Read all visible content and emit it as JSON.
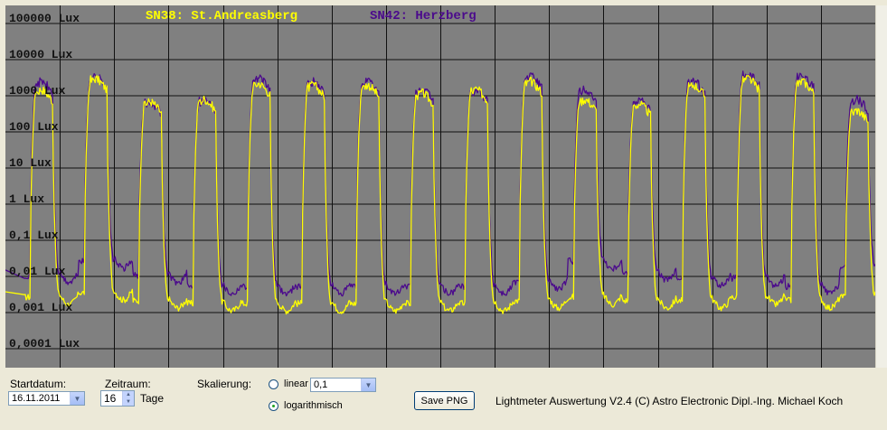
{
  "chart_data": {
    "type": "line",
    "yscale": "log",
    "ylim": [
      0.0001,
      100000
    ],
    "grid": true,
    "legend_placement": "top",
    "y_tick_labels": [
      "100000 Lux",
      "10000 Lux",
      "1000 Lux",
      "100 Lux",
      "10 Lux",
      "1 Lux",
      "0,1 Lux",
      "0,01 Lux",
      "0,001 Lux",
      "0,0001 Lux"
    ],
    "y_tick_values": [
      100000,
      10000,
      1000,
      100,
      10,
      1,
      0.1,
      0.01,
      0.001,
      0.0001
    ],
    "x_days": 16,
    "series": [
      {
        "name": "SN38: St.Andreasberg",
        "color": "#ffff00",
        "day_peaks_lux": [
          1500,
          3000,
          700,
          800,
          2200,
          2000,
          2000,
          1200,
          1500,
          2500,
          800,
          600,
          2000,
          3000,
          2500,
          400
        ],
        "night_min_lux": [
          0.0015,
          0.002,
          0.0012,
          0.001,
          0.001,
          0.001,
          0.001,
          0.001,
          0.001,
          0.0012,
          0.0015,
          0.0012,
          0.0012,
          0.0015,
          0.0012,
          0.0015
        ]
      },
      {
        "name": "SN42: Herzberg",
        "color": "#4b0a8c",
        "day_peaks_lux": [
          2500,
          3500,
          700,
          800,
          3000,
          2500,
          2500,
          1500,
          1500,
          3500,
          1500,
          800,
          2500,
          4000,
          3500,
          800
        ],
        "night_min_lux": [
          0.006,
          0.015,
          0.006,
          0.003,
          0.003,
          0.003,
          0.003,
          0.003,
          0.003,
          0.004,
          0.015,
          0.007,
          0.005,
          0.005,
          0.003,
          0.01
        ]
      }
    ]
  },
  "controls": {
    "startdatum_label": "Startdatum:",
    "startdatum_value": "16.11.2011",
    "zeitraum_label": "Zeitraum:",
    "zeitraum_value": "16",
    "tage_label": "Tage",
    "skalierung_label": "Skalierung:",
    "linear_label": "linear",
    "linear_value": "0,1",
    "log_label": "logarithmisch",
    "selected_scale": "logarithmisch",
    "save_label": "Save PNG",
    "credits": "Lightmeter Auswertung V2.4  (C) Astro Electronic Dipl.-Ing. Michael Koch"
  }
}
